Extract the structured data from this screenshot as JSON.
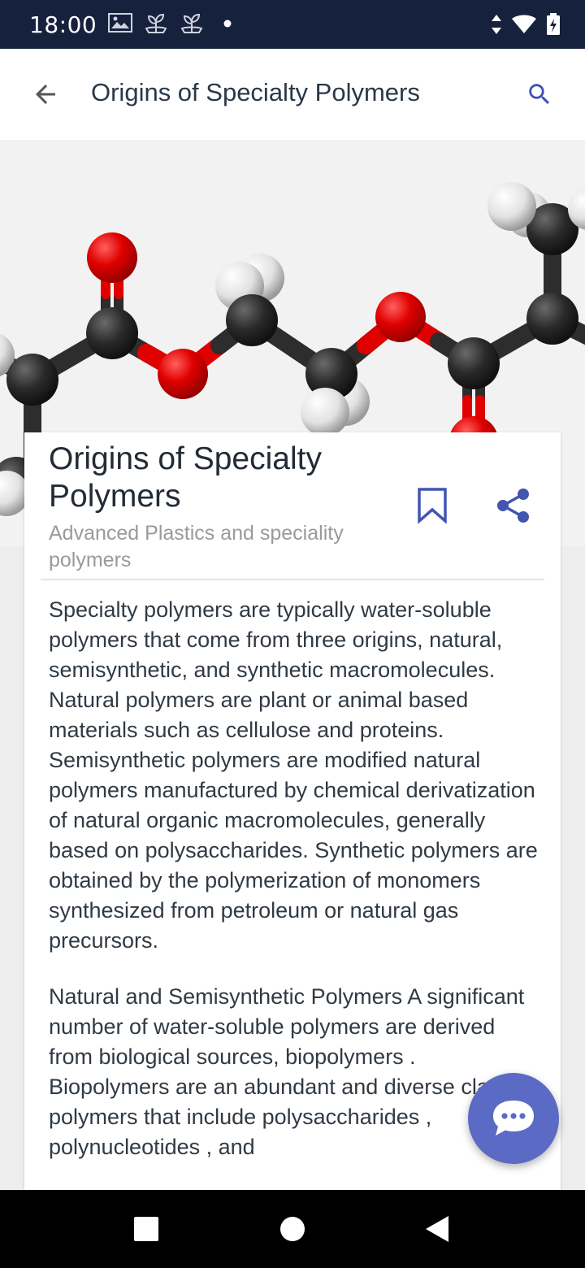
{
  "status_bar": {
    "time": "18:00",
    "icons": [
      "photo-icon",
      "plant-icon",
      "plant-icon",
      "dot-icon",
      "data-arrows-icon",
      "wifi-icon",
      "battery-charging-icon"
    ]
  },
  "app_bar": {
    "title": "Origins of Specialty Polymers",
    "back_icon": "arrow-left-icon",
    "search_icon": "search-icon"
  },
  "hero": {
    "image": "molecule-ball-and-stick-image",
    "colors": {
      "carbon": "#2b2b2b",
      "oxygen": "#e00000",
      "hydrogen": "#f0f0f0"
    }
  },
  "article": {
    "title": "Origins of Specialty Polymers",
    "subtitle": "Advanced Plastics and speciality polymers",
    "bookmark_icon": "bookmark-icon",
    "share_icon": "share-icon",
    "paragraphs": [
      "Specialty polymers are typically water-soluble polymers that come from three origins, natural, semisynthetic, and synthetic macromolecules. Natural polymers are plant or animal based materials such as cellulose and proteins. Semisynthetic polymers are modified natural polymers manufactured by chemical derivatization of natural organic macromolecules, generally based on polysaccharides. Synthetic polymers are obtained by the polymerization of monomers synthesized from petroleum or natural gas precursors.",
      "Natural and Semisynthetic Polymers A significant number of water-soluble polymers are derived from biological sources, biopolymers . Biopolymers are an abundant and diverse class of polymers that include polysaccharides , polynucleotides , and"
    ]
  },
  "fab": {
    "icon": "chat-bubble-icon",
    "color": "#5b6ac4"
  },
  "nav_bar": {
    "icons": [
      "square-recents-icon",
      "circle-home-icon",
      "triangle-back-icon"
    ]
  },
  "colors": {
    "status_bar": "#16213e",
    "accent": "#5b6ac4",
    "text": "#303a44"
  }
}
